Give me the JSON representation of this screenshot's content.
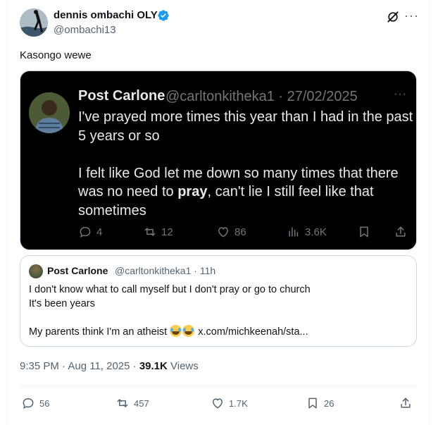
{
  "author": {
    "name": "dennis ombachi OLY",
    "handle": "@ombachi13",
    "verified_icon": "verified-badge-icon",
    "accent": "#1d9bf0"
  },
  "header_icons": [
    "grok-icon",
    "more-icon"
  ],
  "tweet": {
    "text": "Kasongo wewe"
  },
  "screenshot": {
    "name": "Post Carlone",
    "handle_date": "@carltonkitheka1 · 27/02/2025",
    "line1": "I've prayed more times this year than I had in the past 5 years or so",
    "line2_before": "I felt like God let me down so many times that there was no need to ",
    "line2_bold": "pray",
    "line2_after": ", can't lie I still feel like that sometimes",
    "stats": {
      "replies": "4",
      "reposts": "12",
      "likes": "86",
      "views": "3.6K"
    }
  },
  "quote": {
    "name": "Post Carlone",
    "handle_time": "@carltonkitheka1 · 11h",
    "line1": "I don't know what to call myself but I don't pray or go to church",
    "line2": "It's been years",
    "line3": "My parents think I'm an atheist",
    "link": "x.com/michkeenah/sta..."
  },
  "meta": {
    "time_date": "9:35 PM · Aug 11, 2025 · ",
    "views_count": "39.1K",
    "views_label": " Views"
  },
  "actions": {
    "replies": "56",
    "reposts": "457",
    "likes": "1.7K",
    "bookmarks": "26"
  }
}
